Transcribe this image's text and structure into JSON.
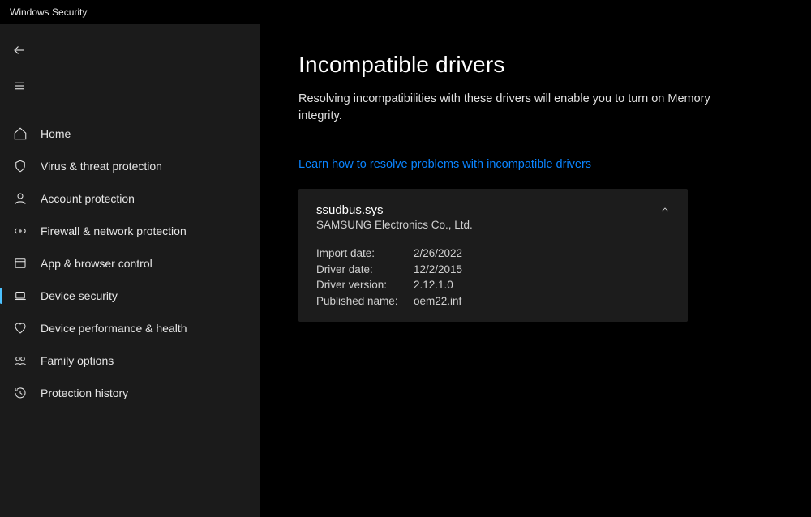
{
  "titlebar": {
    "title": "Windows Security"
  },
  "sidebar": {
    "items": [
      {
        "label": "Home"
      },
      {
        "label": "Virus & threat protection"
      },
      {
        "label": "Account protection"
      },
      {
        "label": "Firewall & network protection"
      },
      {
        "label": "App & browser control"
      },
      {
        "label": "Device security"
      },
      {
        "label": "Device performance & health"
      },
      {
        "label": "Family options"
      },
      {
        "label": "Protection history"
      }
    ]
  },
  "content": {
    "title": "Incompatible drivers",
    "subtitle": "Resolving incompatibilities with these drivers will enable you to turn on Memory integrity.",
    "link_label": "Learn how to resolve problems with incompatible drivers",
    "driver": {
      "filename": "ssudbus.sys",
      "vendor": "SAMSUNG Electronics Co., Ltd.",
      "rows": [
        {
          "label": "Import date:",
          "value": "2/26/2022"
        },
        {
          "label": "Driver date:",
          "value": "12/2/2015"
        },
        {
          "label": "Driver version:",
          "value": "2.12.1.0"
        },
        {
          "label": "Published name:",
          "value": "oem22.inf"
        }
      ]
    }
  }
}
